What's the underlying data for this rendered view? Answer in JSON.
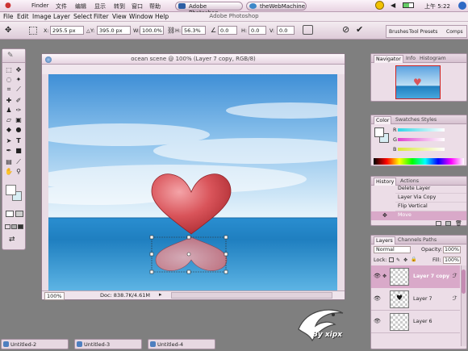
{
  "mac_menubar": {
    "items": [
      "Finder",
      "文件",
      "编辑",
      "显示",
      "转到",
      "窗口",
      "帮助"
    ],
    "running_apps": [
      "Adobe Photoshop",
      "theWebMachine"
    ],
    "clock": "上午 5:22",
    "status_icons": [
      "radiation-icon",
      "speaker-icon",
      "battery-icon",
      "spotlight-icon"
    ]
  },
  "app_title": "Adobe Photoshop",
  "ps_menu": [
    "File",
    "Edit",
    "Image",
    "Layer",
    "Select",
    "Filter",
    "View",
    "Window",
    "Help"
  ],
  "options_bar": {
    "x_label": "X:",
    "x_value": "295.5 px",
    "y_label": "Y:",
    "y_value": "395.0 px",
    "w_label": "W:",
    "w_value": "100.0%",
    "h_label": "H:",
    "h_value": "56.3%",
    "angle_value": "0.0",
    "hskew_label": "H:",
    "hskew_value": "0.0",
    "vskew_label": "V:",
    "vskew_value": "0.0",
    "palette_tabs": [
      "Brushes",
      "Tool Presets",
      "Comps"
    ]
  },
  "document": {
    "title": "ocean scene @ 100% (Layer 7 copy, RGB/8)",
    "zoom": "100%",
    "doc_size": "Doc: 838.7K/4.61M",
    "colors": {
      "sky_top": "#3f8fd6",
      "sea": "#1f7fc0",
      "heart": "#d9545a"
    }
  },
  "navigator": {
    "tabs": [
      "Navigator",
      "Info",
      "Histogram"
    ]
  },
  "color_panel": {
    "tabs": [
      "Color",
      "Swatches",
      "Styles"
    ],
    "channels": [
      "R",
      "G",
      "B"
    ],
    "colors": {
      "r": "#2fd7e6",
      "g": "#e040d0",
      "b": "#d8e838"
    }
  },
  "history": {
    "tabs": [
      "History",
      "Actions"
    ],
    "items": [
      "Delete Layer",
      "Layer Via Copy",
      "Flip Vertical",
      "Move"
    ]
  },
  "layers": {
    "tabs": [
      "Layers",
      "Channels",
      "Paths"
    ],
    "blend_mode": "Normal",
    "opacity_label": "Opacity:",
    "opacity": "100%",
    "lock_label": "Lock:",
    "fill_label": "Fill:",
    "fill": "100%",
    "items": [
      "Layer 7 copy",
      "Layer 7",
      "Layer 6"
    ]
  },
  "taskbar": [
    "Untitled-2",
    "Untitled-3",
    "Untitled-4"
  ],
  "watermark": {
    "text": "By xipx"
  }
}
